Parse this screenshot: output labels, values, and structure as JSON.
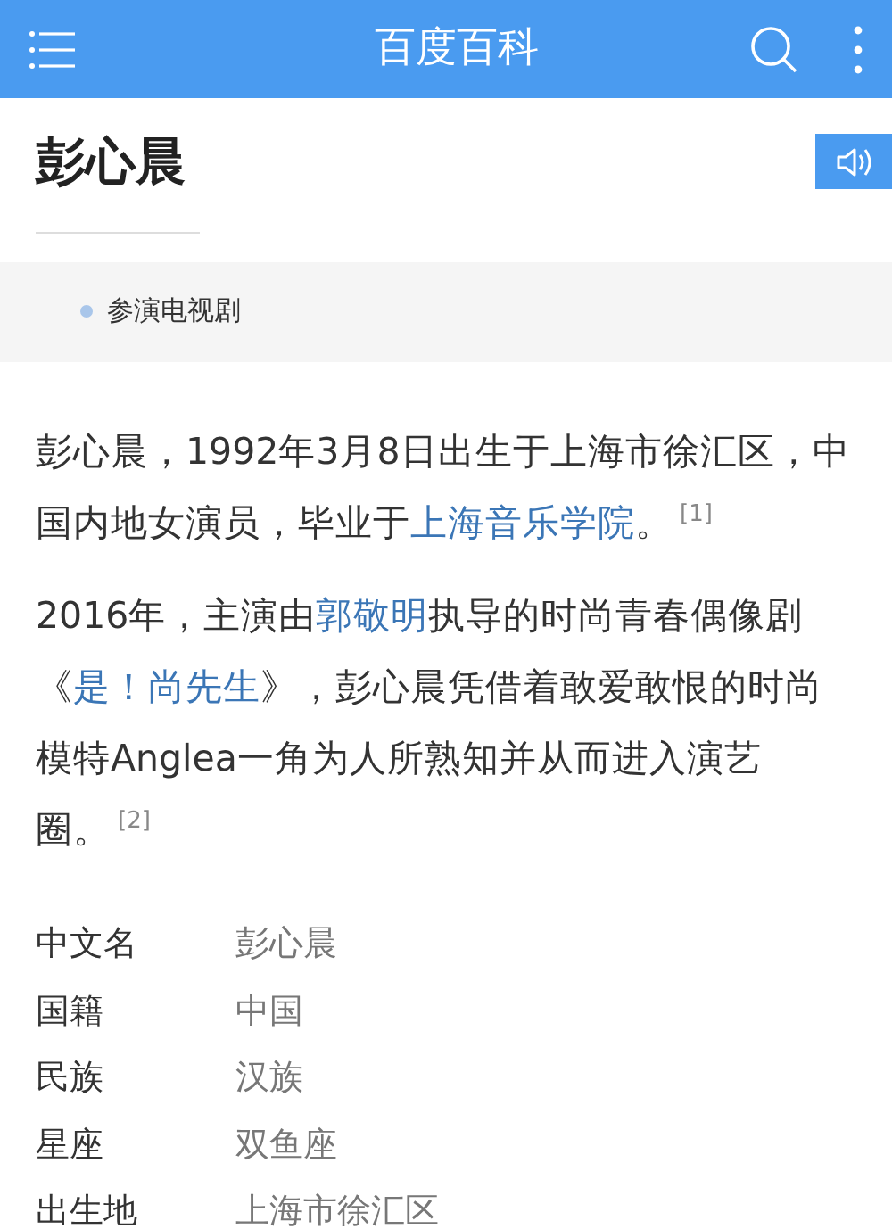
{
  "topbar": {
    "title": "百度百科"
  },
  "article": {
    "title": "彭心晨"
  },
  "catalog": [
    {
      "label": "参演电视剧"
    }
  ],
  "paragraphs": [
    [
      {
        "kind": "text",
        "text": "彭心晨，1992年3月8日出生于上海市徐汇区，中国内地女演员，毕业于"
      },
      {
        "kind": "link",
        "text": "上海音乐学院"
      },
      {
        "kind": "text",
        "text": "。"
      },
      {
        "kind": "ref",
        "text": "[1]"
      }
    ],
    [
      {
        "kind": "text",
        "text": "2016年，主演由"
      },
      {
        "kind": "link",
        "text": "郭敬明"
      },
      {
        "kind": "text",
        "text": "执导的时尚青春偶像剧《"
      },
      {
        "kind": "link",
        "text": "是！尚先生"
      },
      {
        "kind": "text",
        "text": "》，彭心晨凭借着敢爱敢恨的时尚模特Anglea一角为人所熟知并从而进入演艺圈。"
      },
      {
        "kind": "ref",
        "text": "[2]"
      }
    ]
  ],
  "infobox": [
    {
      "label": "中文名",
      "value": "彭心晨"
    },
    {
      "label": "国籍",
      "value": "中国"
    },
    {
      "label": "民族",
      "value": "汉族"
    },
    {
      "label": "星座",
      "value": "双鱼座"
    },
    {
      "label": "出生地",
      "value": "上海市徐汇区"
    }
  ]
}
